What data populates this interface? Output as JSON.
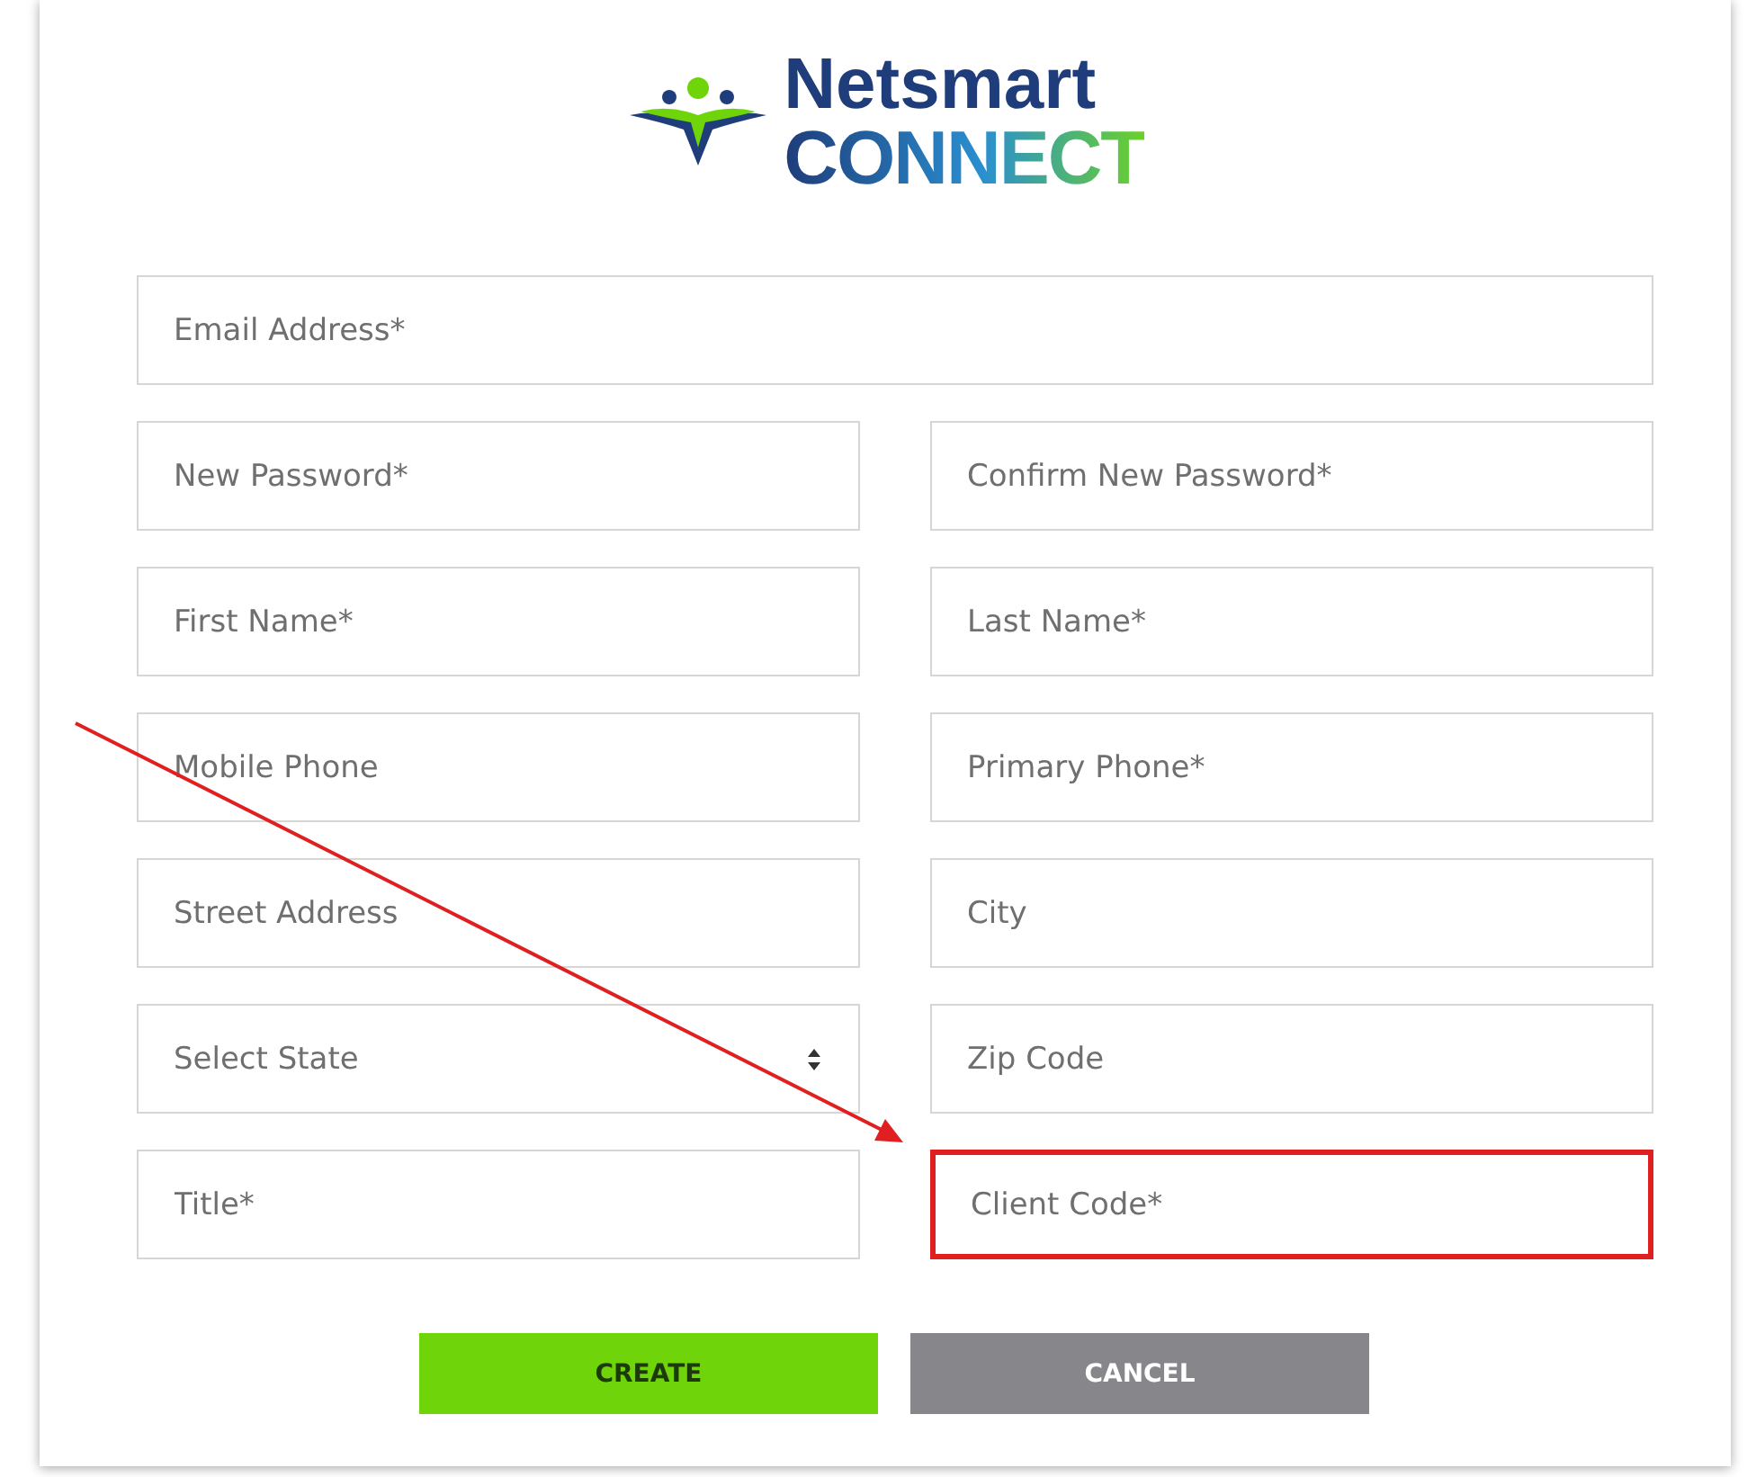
{
  "logo": {
    "line_1": "Netsmart",
    "line_2": "CONNECT"
  },
  "rows": [
    [
      {
        "kind": "input",
        "placeholder": "Email Address*",
        "highlighted": false
      }
    ],
    [
      {
        "kind": "input",
        "placeholder": "New Password*",
        "highlighted": false
      },
      {
        "kind": "input",
        "placeholder": "Confirm New Password*",
        "highlighted": false
      }
    ],
    [
      {
        "kind": "input",
        "placeholder": "First Name*",
        "highlighted": false
      },
      {
        "kind": "input",
        "placeholder": "Last Name*",
        "highlighted": false
      }
    ],
    [
      {
        "kind": "input",
        "placeholder": "Mobile Phone",
        "highlighted": false
      },
      {
        "kind": "input",
        "placeholder": "Primary Phone*",
        "highlighted": false
      }
    ],
    [
      {
        "kind": "input",
        "placeholder": "Street Address",
        "highlighted": false
      },
      {
        "kind": "input",
        "placeholder": "City",
        "highlighted": false
      }
    ],
    [
      {
        "kind": "select",
        "placeholder": "Select State",
        "highlighted": false
      },
      {
        "kind": "input",
        "placeholder": "Zip Code",
        "highlighted": false
      }
    ],
    [
      {
        "kind": "input",
        "placeholder": "Title*",
        "highlighted": false
      },
      {
        "kind": "input",
        "placeholder": "Client Code*",
        "highlighted": true
      }
    ]
  ],
  "buttons": [
    {
      "kind": "primary",
      "label": "CREATE"
    },
    {
      "kind": "secondary",
      "label": "CANCEL"
    }
  ],
  "annotation": {
    "kind": "arrow"
  }
}
